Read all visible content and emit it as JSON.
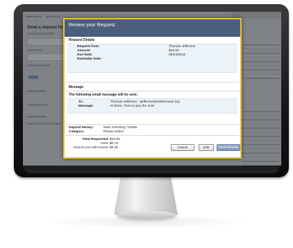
{
  "background_page": {
    "tabs": [
      "Send Money",
      "Split the Bill"
    ],
    "heading": "Send a request for"
  },
  "dialog": {
    "title": "Review your Request",
    "request_details_heading": "Request Details",
    "request_details": [
      {
        "label": "Request from:",
        "value": "Thomas Jefferson"
      },
      {
        "label": "Amount:",
        "value": "$10.00"
      },
      {
        "label": "Due Date:",
        "value": "05/24/2016"
      },
      {
        "label": "Reminder Date:",
        "value": ""
      }
    ],
    "message_heading": "Message",
    "email_heading": "The following email message will be sent:",
    "email": [
      {
        "label": "To:",
        "value": "Thomas Jefferson - tjefferson@whitehouse.org"
      },
      {
        "label": "Message:",
        "value": "Hi there. Time to pay the rent!"
      }
    ],
    "deposit": [
      {
        "label": "Deposit Money:",
        "value": "Main Checking *23456"
      },
      {
        "label": "Category:",
        "value": "Please Select"
      }
    ],
    "totals": [
      {
        "label": "Total Requested:",
        "value": "$10.00"
      },
      {
        "label": "Fees:",
        "value": "$0.75"
      },
      {
        "label": "Amount you will receive:",
        "value": "$9.25"
      }
    ],
    "buttons": {
      "cancel": "Cancel",
      "edit": "Edit",
      "send": "Send Request"
    }
  },
  "colors": {
    "header": "#4b5e7b",
    "border_highlight": "#f2c12e",
    "panel": "#ebf2f8",
    "primary_button": "#7c93b2"
  }
}
